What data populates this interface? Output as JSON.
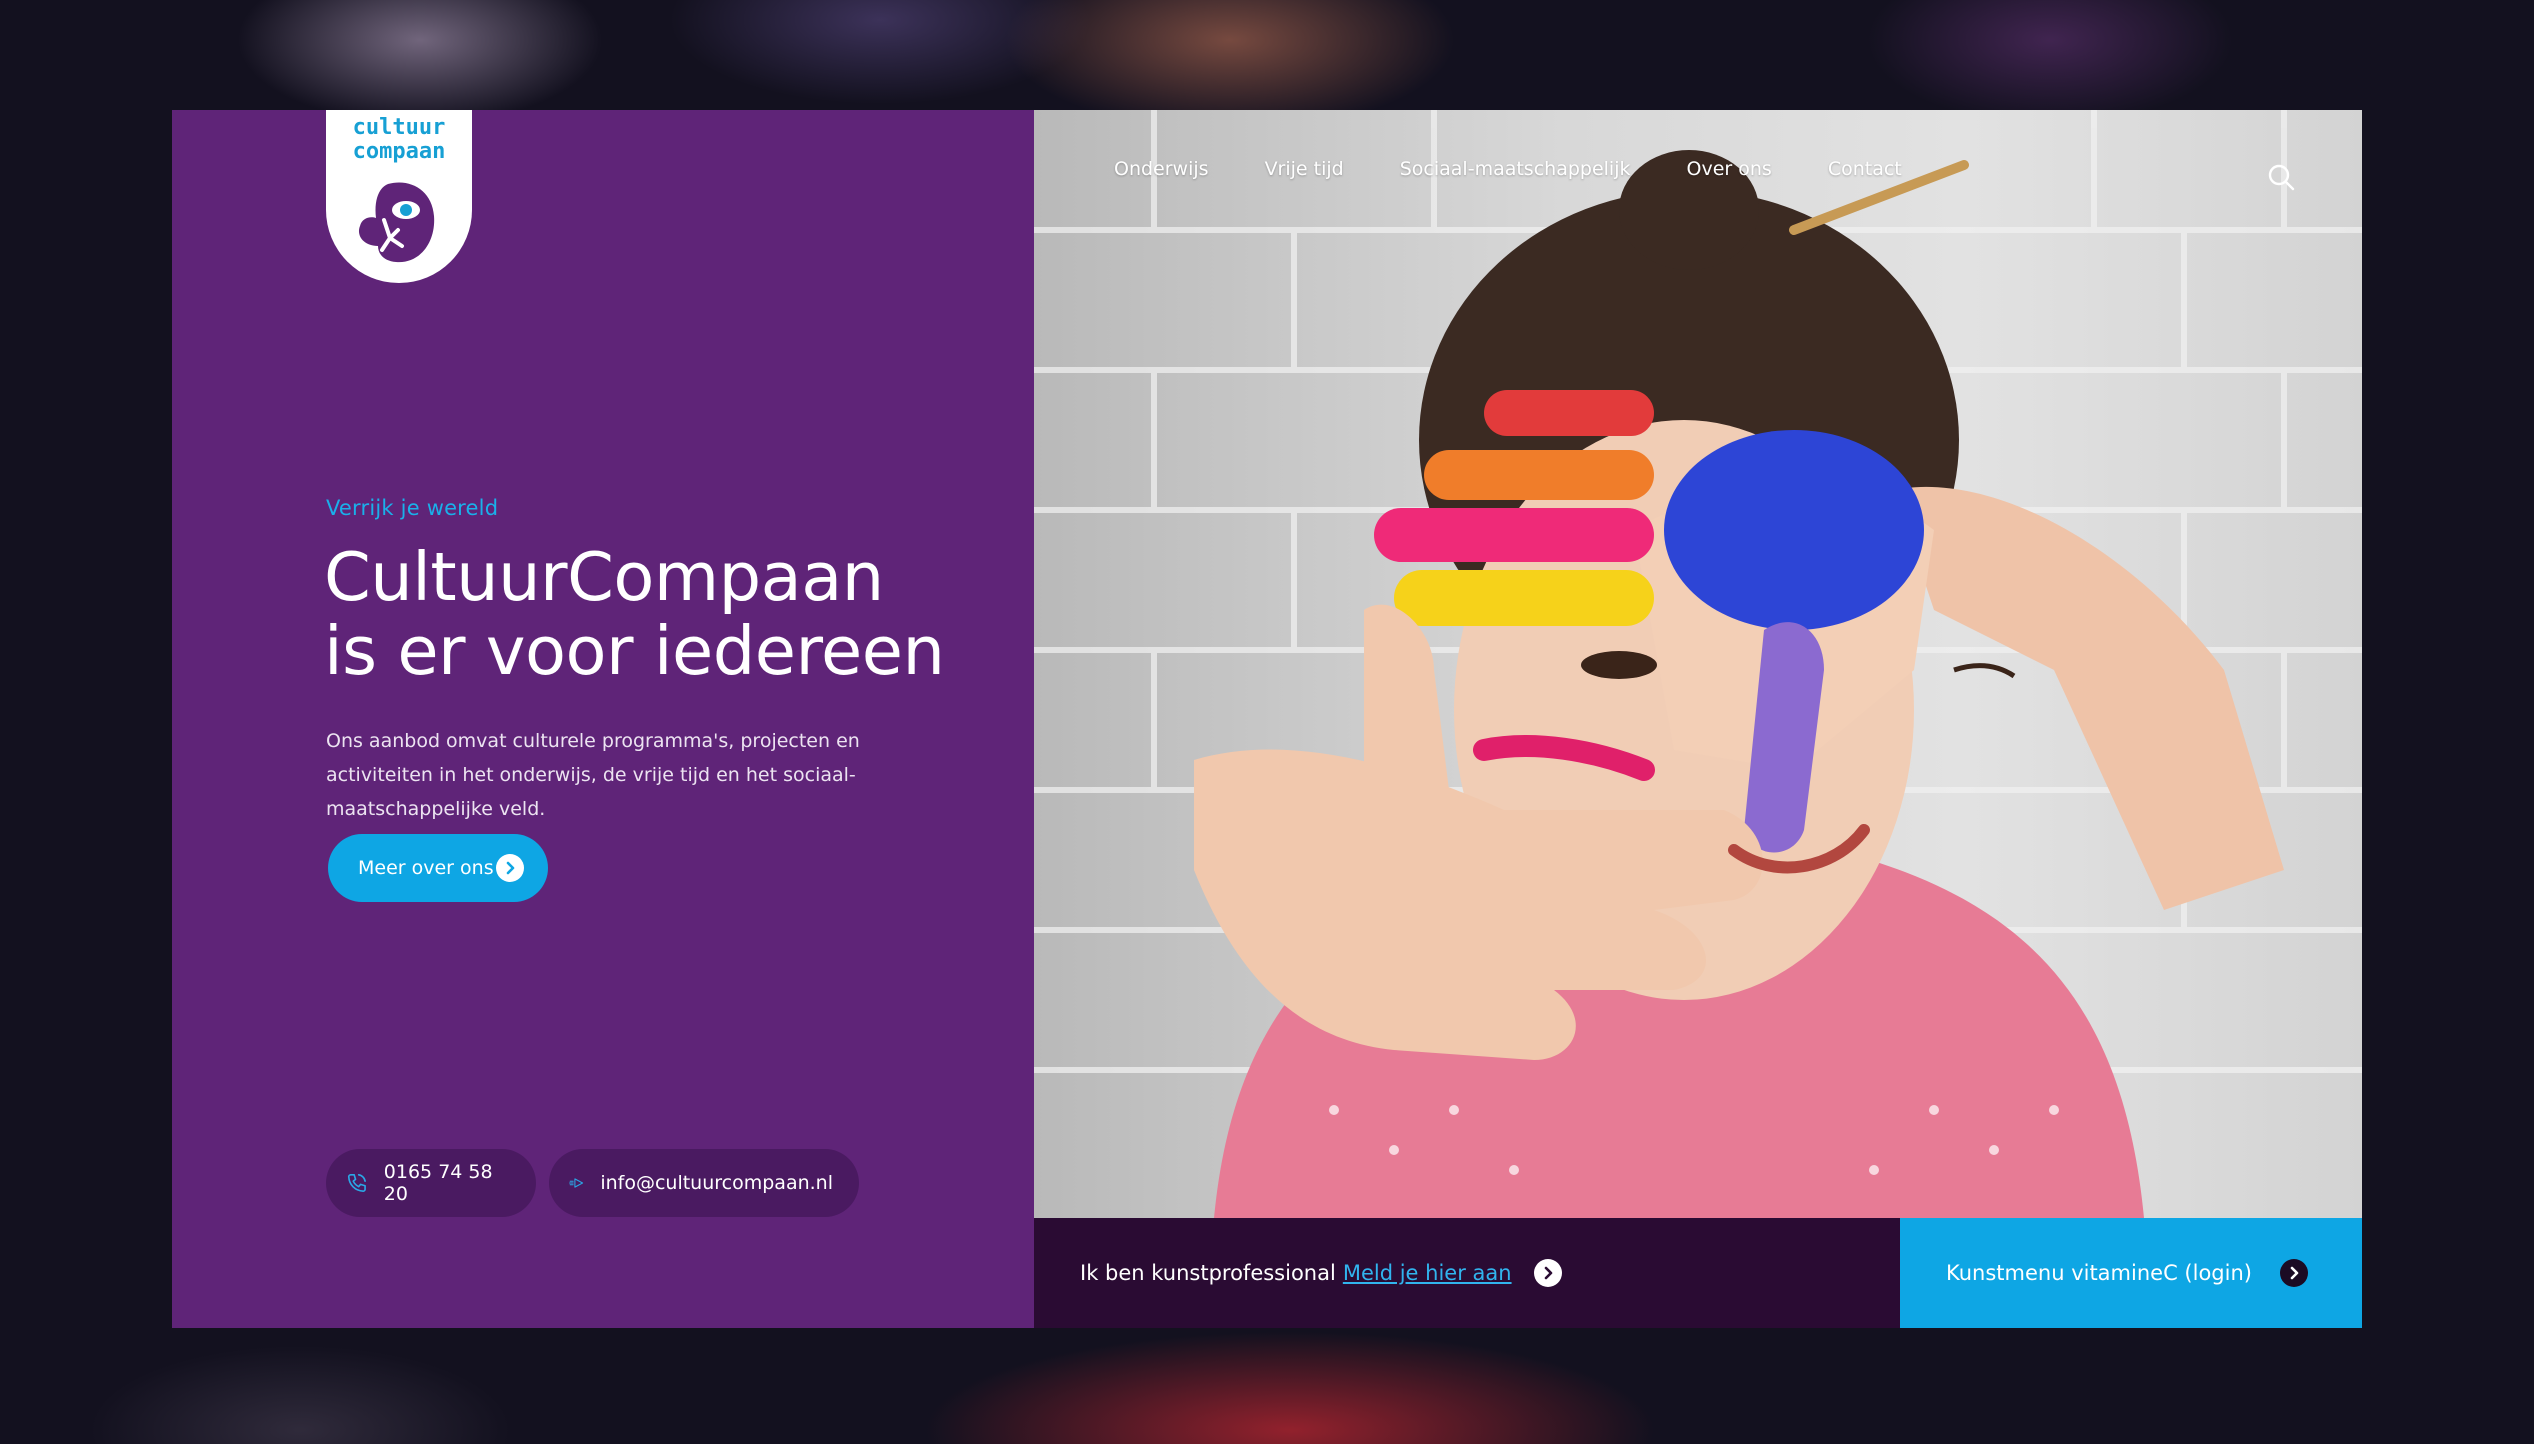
{
  "brand": {
    "logo_line1": "cultuur",
    "logo_line2": "compaan"
  },
  "nav": {
    "items": [
      "Onderwijs",
      "Vrije tijd",
      "Sociaal-maatschappelijk",
      "Over ons",
      "Contact"
    ]
  },
  "hero": {
    "eyebrow": "Verrijk je wereld",
    "title_line1": "CultuurCompaan",
    "title_line2": "is er voor iedereen",
    "intro": "Ons aanbod omvat culturele programma's, projecten en activiteiten in het onderwijs, de vrije tijd en het sociaal-maatschappelijke veld.",
    "cta_label": "Meer over ons"
  },
  "contact": {
    "phone": "0165 74 58 20",
    "email": "info@cultuurcompaan.nl"
  },
  "footer_bar": {
    "professional_text": "Ik ben kunstprofessional",
    "professional_link": "Meld je hier aan",
    "login_label": "Kunstmenu vitamineC (login)"
  },
  "colors": {
    "purple": "#5f2478",
    "blue": "#0ea6e4",
    "dark": "#2a0b33"
  }
}
